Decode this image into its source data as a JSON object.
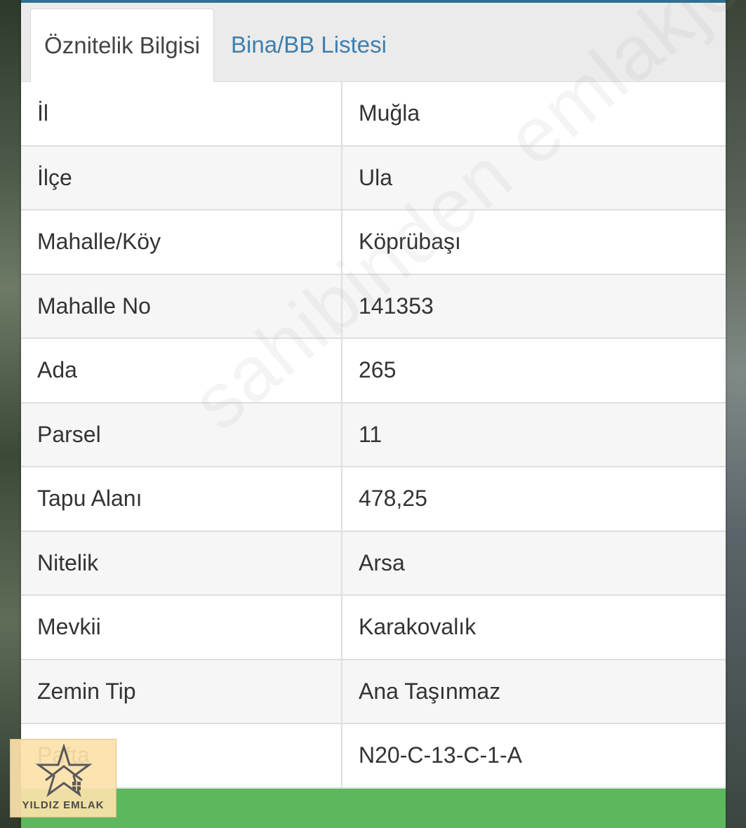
{
  "tabs": [
    {
      "label": "Öznitelik Bilgisi",
      "active": true
    },
    {
      "label": "Bina/BB Listesi",
      "active": false
    }
  ],
  "rows": [
    {
      "key": "İl",
      "value": "Muğla"
    },
    {
      "key": "İlçe",
      "value": "Ula"
    },
    {
      "key": "Mahalle/Köy",
      "value": "Köprübaşı"
    },
    {
      "key": "Mahalle No",
      "value": "141353"
    },
    {
      "key": "Ada",
      "value": "265"
    },
    {
      "key": "Parsel",
      "value": "11"
    },
    {
      "key": "Tapu Alanı",
      "value": "478,25"
    },
    {
      "key": "Nitelik",
      "value": "Arsa"
    },
    {
      "key": "Mevkii",
      "value": "Karakovalık"
    },
    {
      "key": "Zemin Tip",
      "value": "Ana Taşınmaz"
    },
    {
      "key": "Pafta",
      "value": "N20-C-13-C-1-A"
    }
  ],
  "watermark": "sahibinden emlakjet.com",
  "logo": {
    "text": "YILDIZ EMLAK",
    "icon": "house-star-logo"
  },
  "colors": {
    "accent_tab_text": "#3d7fae",
    "top_rule": "#2f6f8f",
    "action_bar": "#5cb85c",
    "logo_bg": "#fce2aa"
  }
}
